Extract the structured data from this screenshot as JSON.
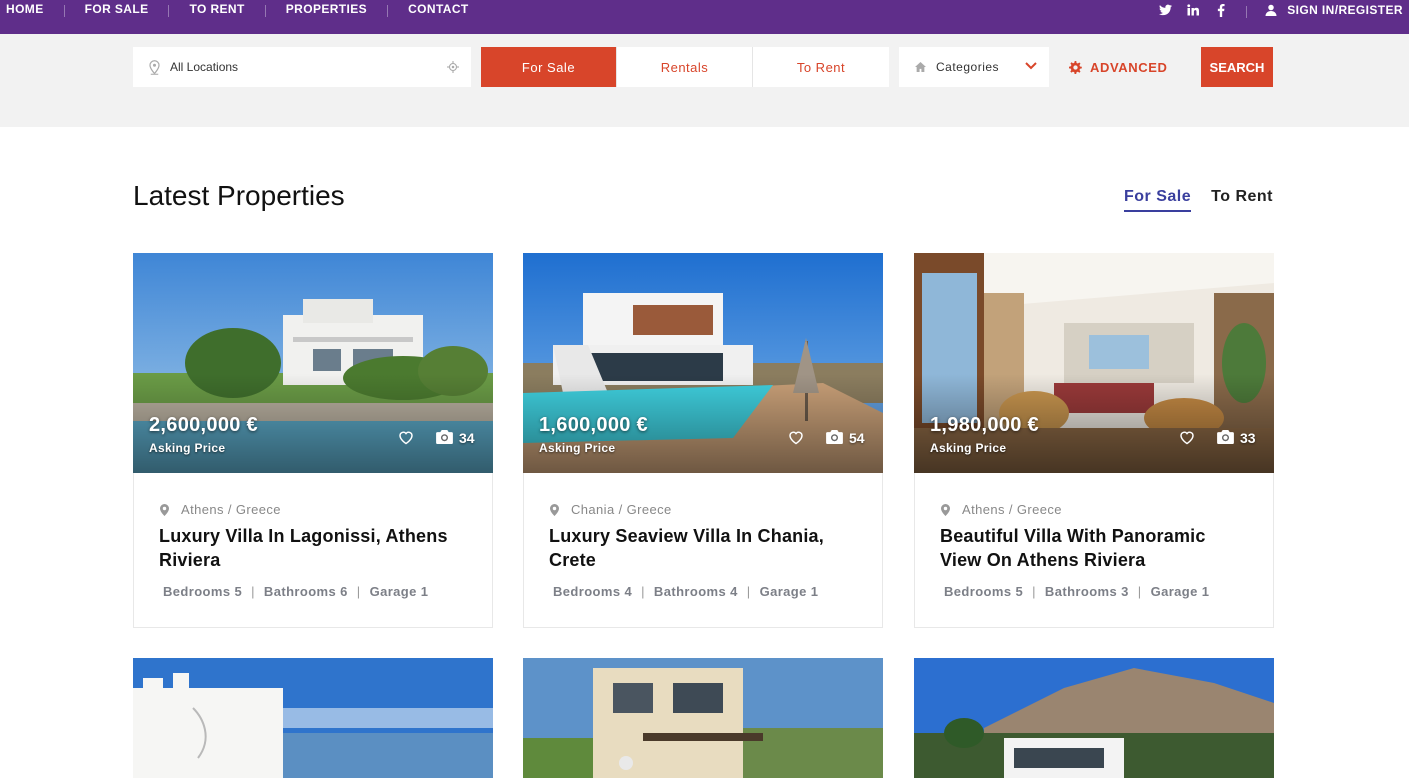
{
  "topnav": {
    "items": [
      "HOME",
      "FOR SALE",
      "TO RENT",
      "PROPERTIES",
      "CONTACT"
    ],
    "signin": "SIGN IN/REGISTER",
    "social": [
      "twitter-icon",
      "linkedin-icon",
      "facebook-icon"
    ]
  },
  "search": {
    "location_placeholder": "All Locations",
    "segments": [
      "For Sale",
      "Rentals",
      "To Rent"
    ],
    "active_segment": "For Sale",
    "categories": "Categories",
    "advanced": "ADVANCED",
    "search_button": "SEARCH"
  },
  "section": {
    "title": "Latest Properties",
    "tabs": [
      "For Sale",
      "To Rent"
    ],
    "active_tab": "For Sale"
  },
  "listings": [
    {
      "price": "2,600,000 €",
      "price_label": "Asking Price",
      "photos": "34",
      "location": "Athens / Greece",
      "title": "Luxury Villa In Lagonissi, Athens Riviera",
      "bedrooms": "Bedrooms 5",
      "bathrooms": "Bathrooms 6",
      "garage": "Garage 1"
    },
    {
      "price": "1,600,000 €",
      "price_label": "Asking Price",
      "photos": "54",
      "location": "Chania / Greece",
      "title": "Luxury Seaview Villa In Chania, Crete",
      "bedrooms": "Bedrooms 4",
      "bathrooms": "Bathrooms 4",
      "garage": "Garage 1"
    },
    {
      "price": "1,980,000 €",
      "price_label": "Asking Price",
      "photos": "33",
      "location": "Athens / Greece",
      "title": "Beautiful Villa With Panoramic View On Athens Riviera",
      "bedrooms": "Bedrooms 5",
      "bathrooms": "Bathrooms 3",
      "garage": "Garage 1"
    }
  ],
  "colors": {
    "topbar": "#5f2e8a",
    "accent": "#d8452a",
    "tab_active": "#3a3f9e"
  }
}
